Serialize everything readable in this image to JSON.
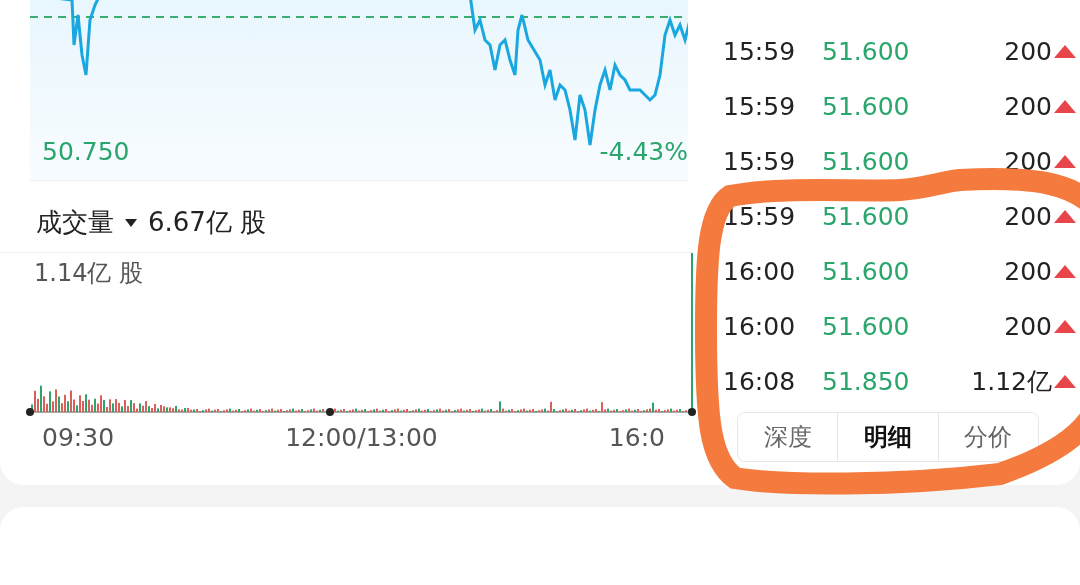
{
  "price_chart": {
    "low_label": "50.750",
    "change_label": "-4.43%"
  },
  "volume": {
    "title": "成交量",
    "total": "6.67亿 股",
    "max_label": "1.14亿 股",
    "time_labels": [
      "09:30",
      "12:00/13:00",
      "16:0"
    ]
  },
  "trades": [
    {
      "time": "15:59",
      "price": "51.600",
      "size": "200",
      "up": true
    },
    {
      "time": "15:59",
      "price": "51.600",
      "size": "200",
      "up": true
    },
    {
      "time": "15:59",
      "price": "51.600",
      "size": "200",
      "up": true
    },
    {
      "time": "15:59",
      "price": "51.600",
      "size": "200",
      "up": true
    },
    {
      "time": "16:00",
      "price": "51.600",
      "size": "200",
      "up": true
    },
    {
      "time": "16:00",
      "price": "51.600",
      "size": "200",
      "up": true
    },
    {
      "time": "16:08",
      "price": "51.850",
      "size": "1.12亿",
      "up": true
    }
  ],
  "tabs": [
    {
      "label": "深度",
      "selected": false
    },
    {
      "label": "明细",
      "selected": true
    },
    {
      "label": "分价",
      "selected": false
    }
  ]
}
